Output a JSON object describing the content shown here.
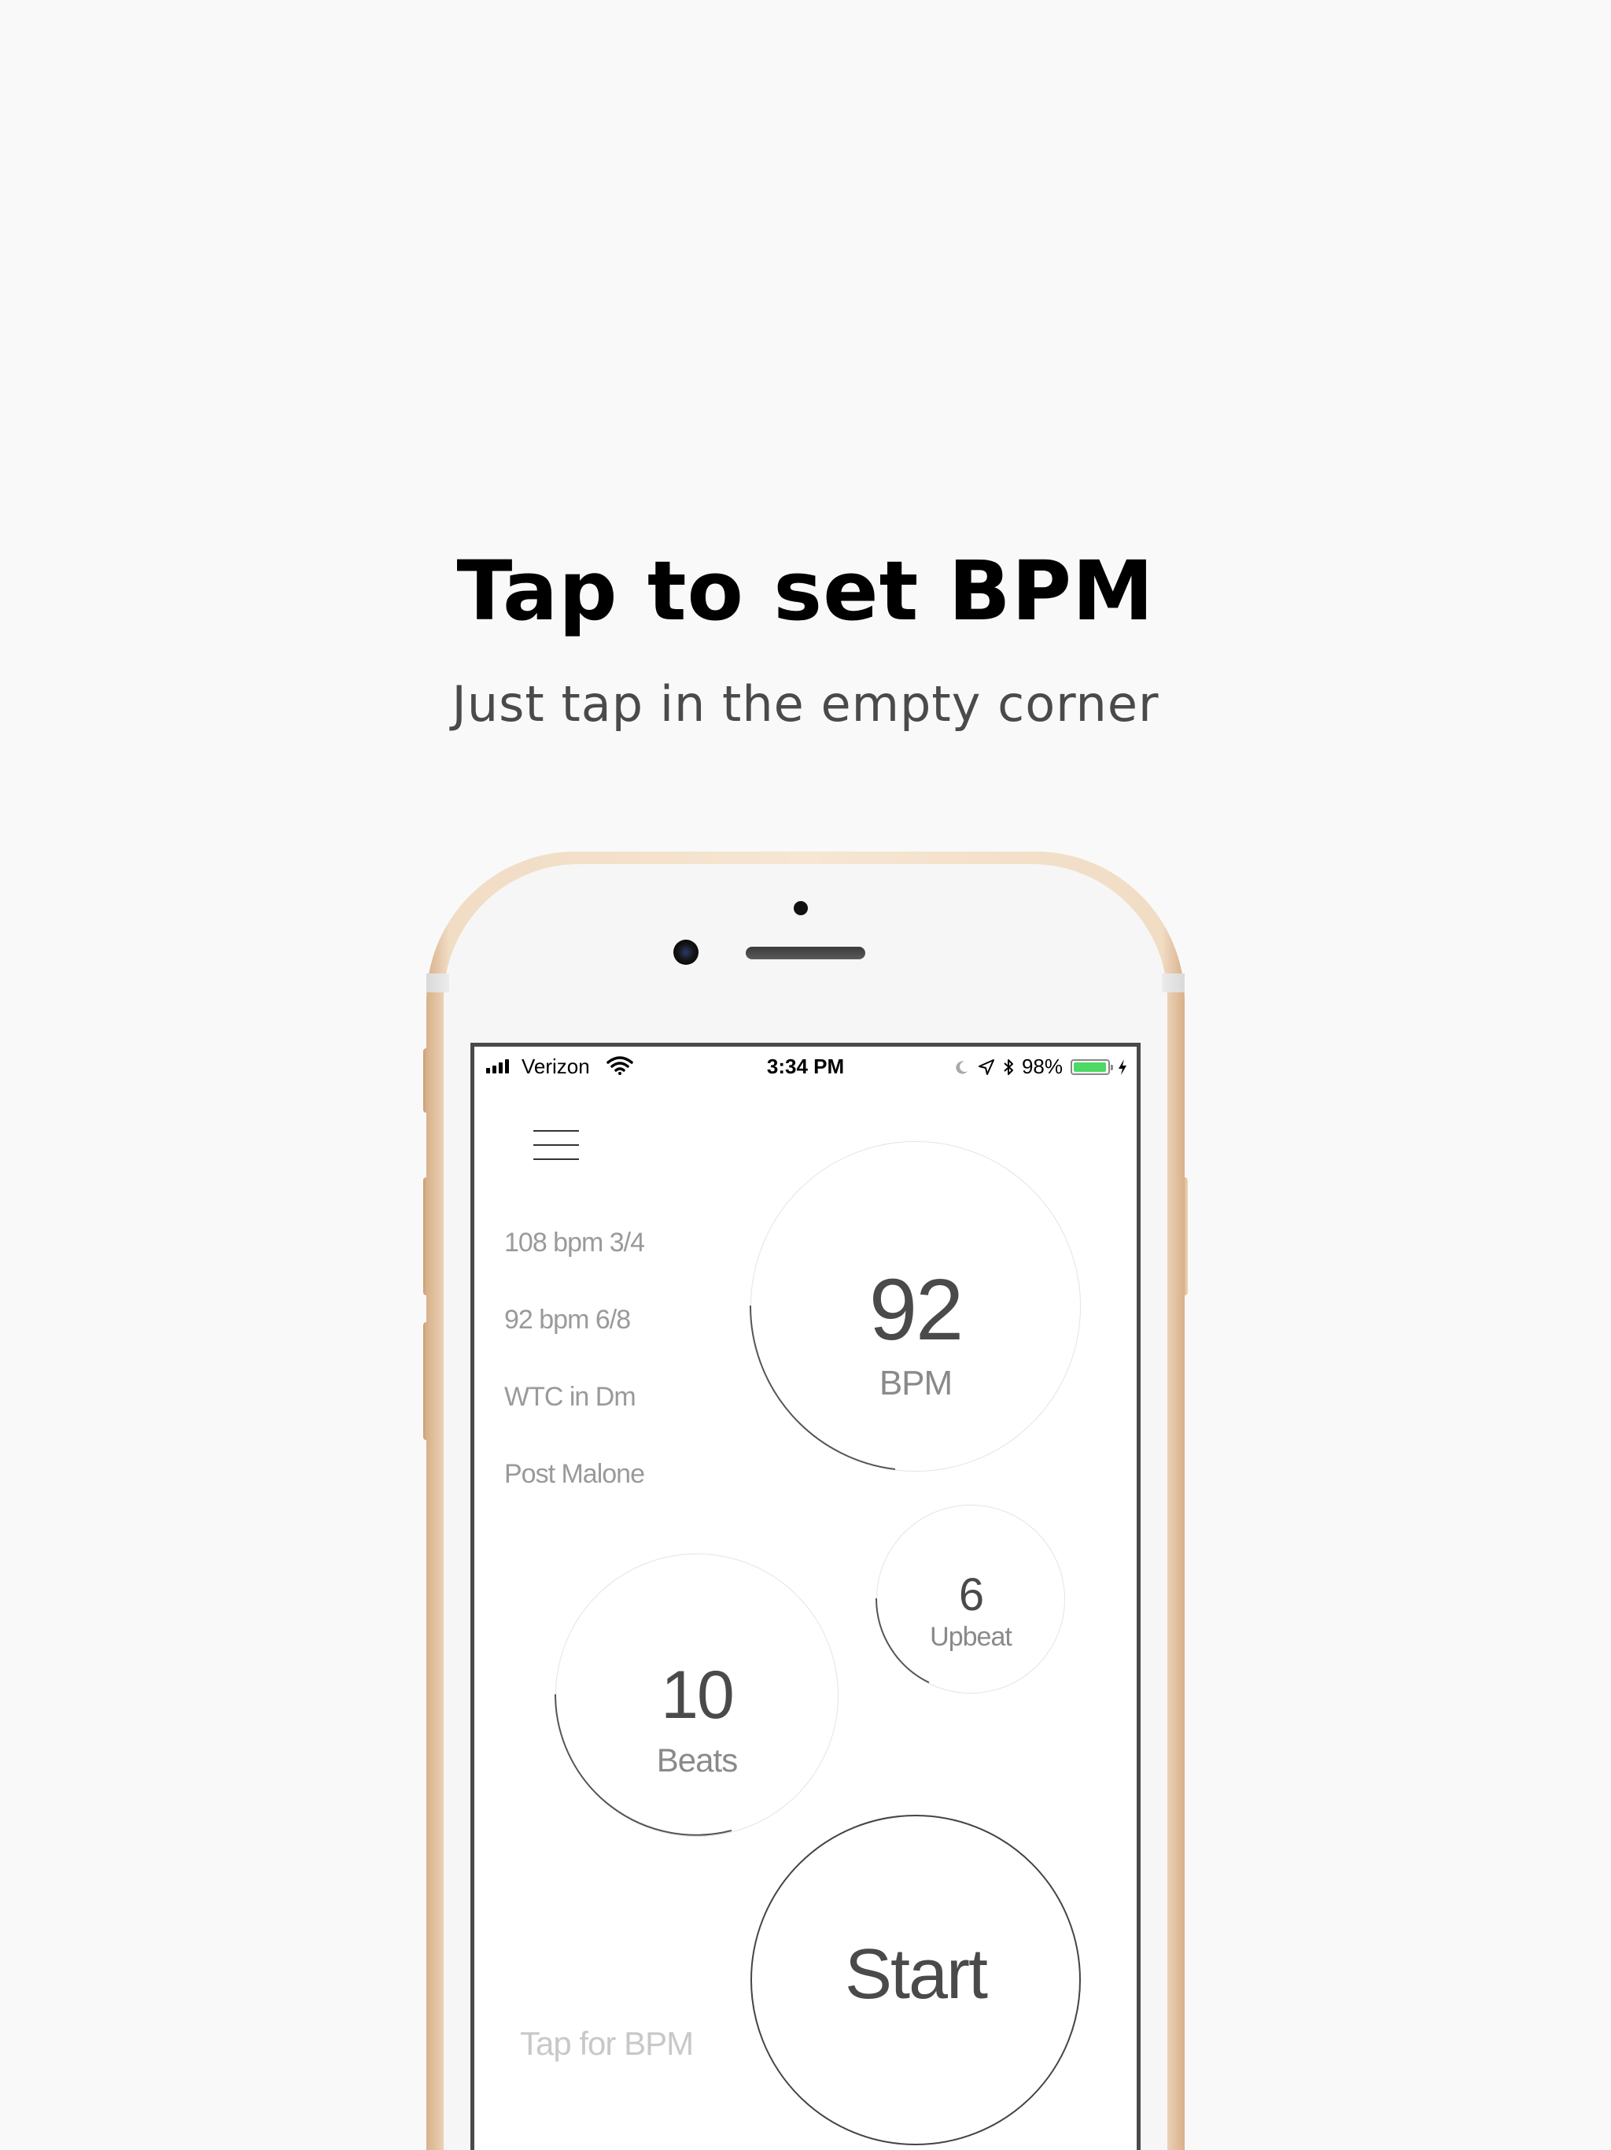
{
  "headline": "Tap to set BPM",
  "subheadline": "Just tap in the empty corner",
  "status_bar": {
    "carrier": "Verizon",
    "time": "3:34 PM",
    "battery_percent": "98%",
    "battery_level": 0.98,
    "icons": [
      "signal-icon",
      "wifi-icon",
      "moon-icon",
      "location-icon",
      "bluetooth-icon",
      "battery-icon",
      "charging-icon"
    ]
  },
  "app": {
    "presets": [
      "108 bpm 3/4",
      "92 bpm 6/8",
      "WTC in Dm",
      "Post Malone"
    ],
    "bpm": {
      "value": "92",
      "label": "BPM"
    },
    "upbeat": {
      "value": "6",
      "label": "Upbeat"
    },
    "beats": {
      "value": "10",
      "label": "Beats"
    },
    "start_label": "Start",
    "tap_label": "Tap for BPM"
  },
  "colors": {
    "background": "#f9f9f9",
    "battery_green": "#4cd964",
    "phone_gold": "#f1dcc4"
  }
}
